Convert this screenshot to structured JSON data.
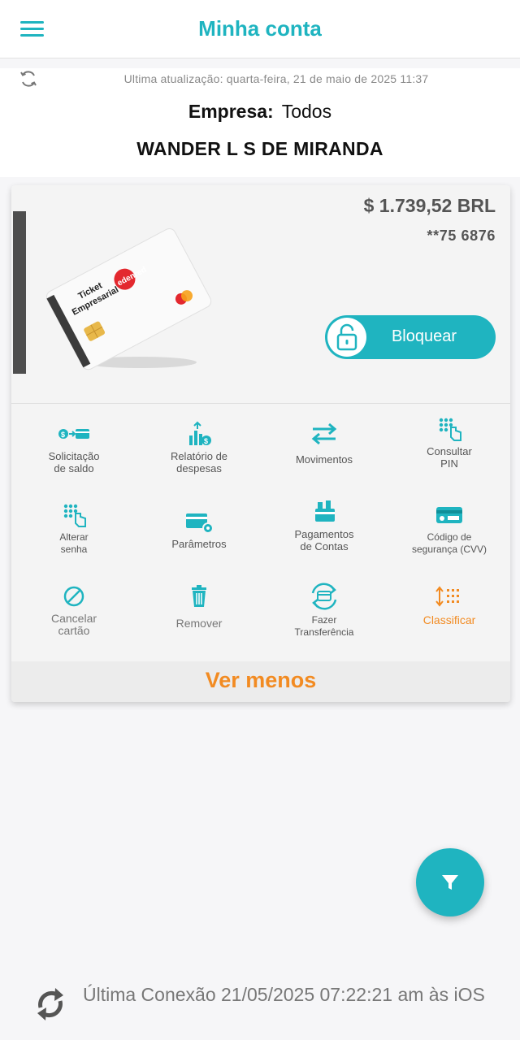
{
  "header": {
    "title": "Minha conta",
    "menu_icon": "hamburger-menu-icon"
  },
  "update": {
    "text": "Ultima atualização: quarta-feira, 21 de maio de 2025 11:37",
    "icon": "refresh-icon"
  },
  "company": {
    "label": "Empresa:",
    "value": "Todos"
  },
  "owner": "WANDER L S DE MIRANDA",
  "card": {
    "balance": "$ 1.739,52 BRL",
    "number": "**75  6876",
    "image_text": {
      "line1": "Ticket",
      "line2": "Empresarial",
      "brand": "edenred"
    },
    "block_button": "Bloquear"
  },
  "actions": [
    {
      "label": "Solicitação\nde saldo",
      "icon": "balance-request-icon"
    },
    {
      "label": "Relatório de\ndespesas",
      "icon": "expense-report-icon"
    },
    {
      "label": "Movimentos",
      "icon": "transfer-arrows-icon"
    },
    {
      "label": "Consultar\nPIN",
      "icon": "keypad-touch-icon"
    },
    {
      "label": "Alterar\nsenha",
      "icon": "keypad-touch-icon"
    },
    {
      "label": "Parâmetros",
      "icon": "card-settings-icon"
    },
    {
      "label": "Pagamentos\nde Contas",
      "icon": "bill-payment-icon"
    },
    {
      "label": "Código de\nsegurança (CVV)",
      "icon": "card-cvv-icon"
    },
    {
      "label": "Cancelar\ncartão",
      "icon": "cancel-icon"
    },
    {
      "label": "Remover",
      "icon": "trash-icon"
    },
    {
      "label": "Fazer\nTransferência",
      "icon": "transfer-card-icon"
    },
    {
      "label": "Classificar",
      "icon": "sort-icon"
    }
  ],
  "ver_menos": "Ver menos",
  "footer": {
    "text": "Última Conexão 21/05/2025 07:22:21 am às iOS",
    "icon": "sync-icon"
  },
  "colors": {
    "primary": "#1fb4c0",
    "accent": "#f28b22",
    "card_red": "#e3282e"
  }
}
